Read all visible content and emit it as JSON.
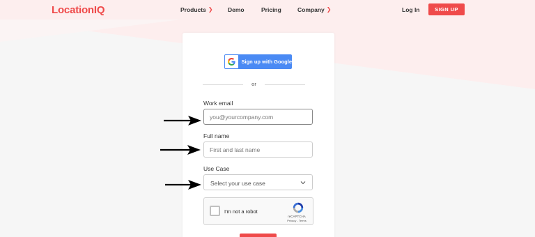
{
  "colors": {
    "brand": "#ef4a4a",
    "google_blue": "#4a8af4"
  },
  "header": {
    "logo": "LocationIQ",
    "nav": [
      {
        "label": "Products",
        "has_dropdown": true
      },
      {
        "label": "Demo",
        "has_dropdown": false
      },
      {
        "label": "Pricing",
        "has_dropdown": false
      },
      {
        "label": "Company",
        "has_dropdown": true
      }
    ],
    "login_label": "Log In",
    "signup_label": "SIGN UP"
  },
  "form": {
    "google_label": "Sign up with Google",
    "or_label": "or",
    "email": {
      "label": "Work email",
      "placeholder": "you@yourcompany.com"
    },
    "name": {
      "label": "Full name",
      "placeholder": "First and last name"
    },
    "use_case": {
      "label": "Use Case",
      "selected": "Select your use case"
    },
    "captcha": {
      "text": "I'm not a robot",
      "brand": "reCAPTCHA",
      "links": "Privacy - Terms"
    }
  },
  "icons": [
    "google-icon",
    "chevron-down-icon",
    "recaptcha-icon",
    "arrow-right-icon"
  ]
}
